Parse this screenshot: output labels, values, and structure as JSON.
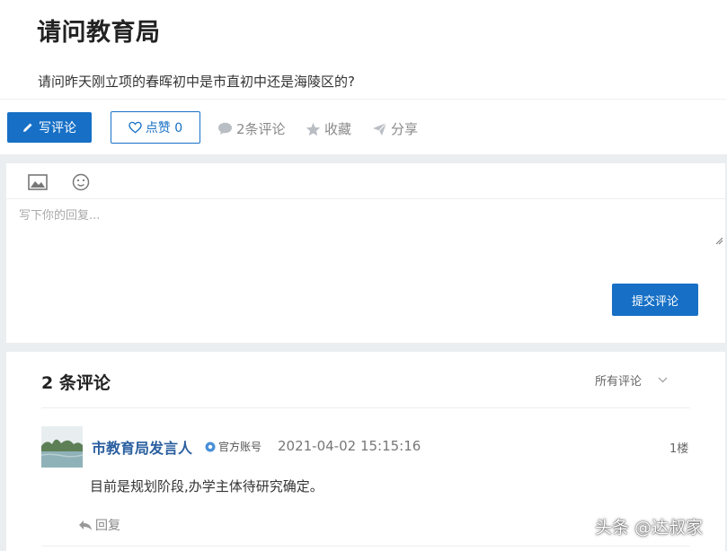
{
  "article": {
    "title": "请问教育局",
    "question": "请问昨天刚立项的春晖初中是市直初中还是海陵区的?"
  },
  "actions": {
    "write_label": "写评论",
    "like_label": "点赞 0",
    "comments_label": "2条评论",
    "favorite_label": "收藏",
    "share_label": "分享"
  },
  "editor": {
    "placeholder": "写下你的回复...",
    "submit_label": "提交评论",
    "tools": [
      "image-icon",
      "emoji-icon"
    ]
  },
  "comments": {
    "heading": "2 条评论",
    "filter_label": "所有评论",
    "items": [
      {
        "author": "市教育局发言人",
        "badge": "官方账号",
        "time": "2021-04-02 15:15:16",
        "floor": "1楼",
        "text": "目前是规划阶段,办学主体待研究确定。",
        "reply_label": "回复"
      }
    ]
  },
  "watermark": "头条 @达叔家",
  "colors": {
    "primary": "#1770c6",
    "author": "#2a5fa0",
    "muted": "#8a8a8a",
    "background": "#ebeef0"
  }
}
